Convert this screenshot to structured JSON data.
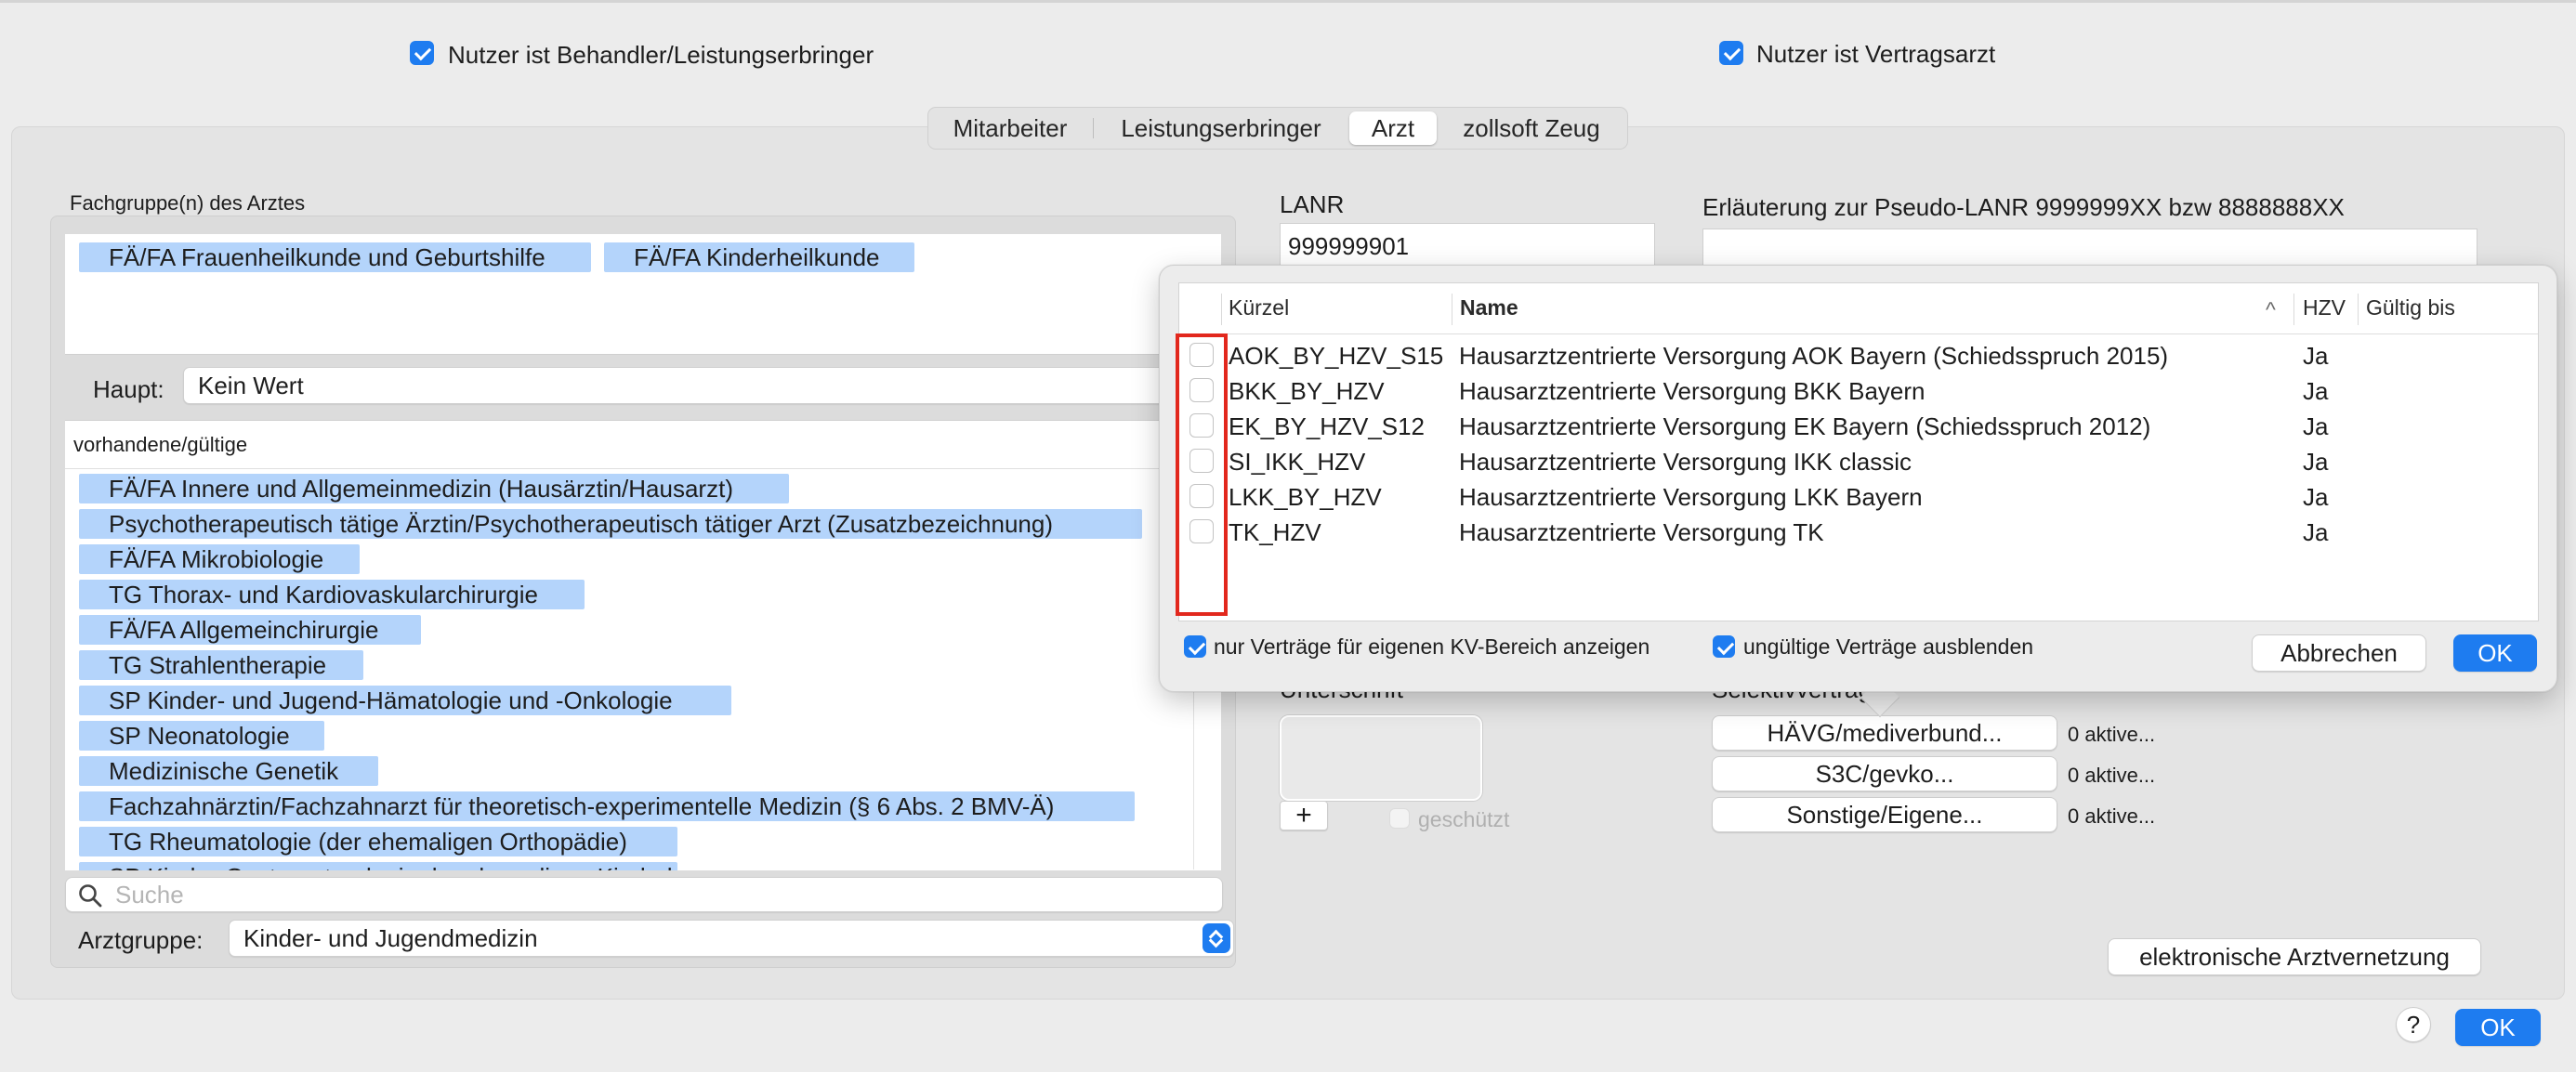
{
  "top_checkboxes": {
    "behandler": {
      "label": "Nutzer ist Behandler/Leistungserbringer",
      "checked": true
    },
    "vertragsarzt": {
      "label": "Nutzer ist Vertragsarzt",
      "checked": true
    }
  },
  "tabs": [
    {
      "label": "Mitarbeiter",
      "selected": false
    },
    {
      "label": "Leistungserbringer",
      "selected": false
    },
    {
      "label": "Arzt",
      "selected": true
    },
    {
      "label": "zollsoft Zeug",
      "selected": false
    }
  ],
  "fachgruppen": {
    "title": "Fachgruppe(n) des Arztes",
    "selected_chips": [
      "FÄ/FA Frauenheilkunde und Geburtshilfe",
      "FÄ/FA Kinderheilkunde"
    ],
    "haupt_label": "Haupt:",
    "haupt_value": "Kein Wert",
    "list_header": "vorhandene/gültige",
    "available": [
      "FÄ/FA Innere und Allgemeinmedizin (Hausärztin/Hausarzt)",
      "Psychotherapeutisch tätige Ärztin/Psychotherapeutisch tätiger Arzt (Zusatzbezeichnung)",
      "FÄ/FA Mikrobiologie",
      "TG Thorax- und Kardiovaskularchirurgie",
      "FÄ/FA Allgemeinchirurgie",
      "TG Strahlentherapie",
      "SP Kinder- und Jugend-Hämatologie und -Onkologie",
      "SP Neonatologie",
      "Medizinische Genetik",
      "Fachzahnärztin/Fachzahnarzt für theoretisch-experimentelle Medizin (§ 6 Abs. 2 BMV-Ä)",
      "TG Rheumatologie (der ehemaligen Orthopädie)",
      "SP Kinder-Gastroenterologie der ehemaligen Kinderheilkunde"
    ],
    "search_placeholder": "Suche",
    "arztgruppe_label": "Arztgruppe:",
    "arztgruppe_value": "Kinder- und Jugendmedizin"
  },
  "lanr": {
    "label": "LANR",
    "value": "999999901",
    "pseudo_label": "Erläuterung zur Pseudo-LANR  9999999XX bzw 8888888XX"
  },
  "popover": {
    "columns": [
      "Kürzel",
      "Name",
      "HZV",
      "Gültig bis"
    ],
    "sort_indicator": "^",
    "rows": [
      {
        "kuerzel": "AOK_BY_HZV_S15",
        "name": "Hausarztzentrierte Versorgung AOK Bayern (Schiedsspruch 2015)",
        "hzv": "Ja",
        "gueltig": ""
      },
      {
        "kuerzel": "BKK_BY_HZV",
        "name": "Hausarztzentrierte Versorgung BKK Bayern",
        "hzv": "Ja",
        "gueltig": ""
      },
      {
        "kuerzel": "EK_BY_HZV_S12",
        "name": "Hausarztzentrierte Versorgung EK Bayern (Schiedsspruch 2012)",
        "hzv": "Ja",
        "gueltig": ""
      },
      {
        "kuerzel": "SI_IKK_HZV",
        "name": "Hausarztzentrierte Versorgung IKK classic",
        "hzv": "Ja",
        "gueltig": ""
      },
      {
        "kuerzel": "LKK_BY_HZV",
        "name": "Hausarztzentrierte Versorgung LKK Bayern",
        "hzv": "Ja",
        "gueltig": ""
      },
      {
        "kuerzel": "TK_HZV",
        "name": "Hausarztzentrierte Versorgung TK",
        "hzv": "Ja",
        "gueltig": ""
      }
    ],
    "filter_kv": {
      "label": "nur Verträge für eigenen KV-Bereich anzeigen",
      "checked": true
    },
    "filter_invalid": {
      "label": "ungültige Verträge ausblenden",
      "checked": true
    },
    "cancel_label": "Abbrechen",
    "ok_label": "OK"
  },
  "unterschrift": {
    "label": "Unterschrift",
    "add_label": "+",
    "geschuetzt_label": "geschützt"
  },
  "selektiv": {
    "label": "Selektivverträge",
    "buttons": [
      {
        "label": "HÄVG/mediverbund...",
        "status": "0 aktive..."
      },
      {
        "label": "S3C/gevko...",
        "status": "0 aktive..."
      },
      {
        "label": "Sonstige/Eigene...",
        "status": "0 aktive..."
      }
    ]
  },
  "vernetzung_label": "elektronische Arztvernetzung",
  "help_label": "?",
  "ok_label": "OK",
  "colors": {
    "accent": "#1e7cf0",
    "selection": "#b4d4fb",
    "highlight_box": "#e2281d"
  }
}
